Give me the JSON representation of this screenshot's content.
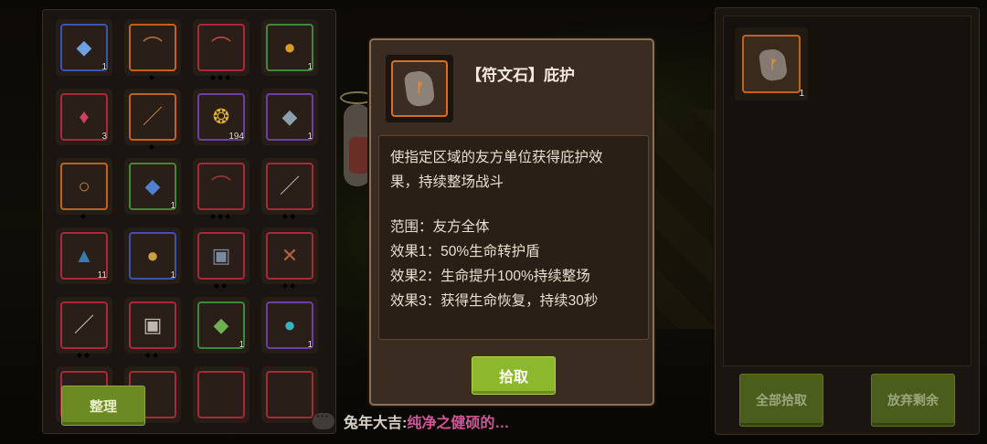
{
  "inventory": {
    "sort_button": "整理",
    "slots": [
      {
        "icon": "blue-gem-icon",
        "glyph": "◆",
        "color": "#6fa0e0",
        "border": "b-blue",
        "count": "1",
        "dots": ""
      },
      {
        "icon": "bow-icon",
        "glyph": "⌒",
        "color": "#b0703a",
        "border": "b-orange",
        "count": "",
        "dots": "◆"
      },
      {
        "icon": "red-bow-icon",
        "glyph": "⌒",
        "color": "#c04848",
        "border": "b-red",
        "count": "",
        "dots": "◆◆◆"
      },
      {
        "icon": "amber-drop-icon",
        "glyph": "●",
        "color": "#d89a2a",
        "border": "b-green",
        "count": "1",
        "dots": ""
      },
      {
        "icon": "potion-icon",
        "glyph": "♦",
        "color": "#d04060",
        "border": "b-red",
        "count": "3",
        "dots": ""
      },
      {
        "icon": "sword-icon",
        "glyph": "／",
        "color": "#d0803a",
        "border": "b-orange",
        "count": "",
        "dots": "◆"
      },
      {
        "icon": "gold-coin-icon",
        "glyph": "❂",
        "color": "#e0b030",
        "border": "b-purple",
        "count": "194",
        "dots": ""
      },
      {
        "icon": "crystal-icon",
        "glyph": "◆",
        "color": "#8aa0b0",
        "border": "b-purple",
        "count": "1",
        "dots": ""
      },
      {
        "icon": "ring-icon",
        "glyph": "○",
        "color": "#c08040",
        "border": "b-orange",
        "count": "",
        "dots": "◆"
      },
      {
        "icon": "sapphire-icon",
        "glyph": "◆",
        "color": "#5080d0",
        "border": "b-green",
        "count": "1",
        "dots": ""
      },
      {
        "icon": "locked-bow-icon",
        "glyph": "⌒",
        "color": "#a03a3a",
        "border": "b-red",
        "count": "",
        "dots": "◆◆◆"
      },
      {
        "icon": "blade-icon",
        "glyph": "／",
        "color": "#c0c0c0",
        "border": "b-red",
        "count": "",
        "dots": "◆◆"
      },
      {
        "icon": "eye-shard-icon",
        "glyph": "▲",
        "color": "#3a7ab0",
        "border": "b-red",
        "count": "11",
        "dots": ""
      },
      {
        "icon": "gold-ore-icon",
        "glyph": "●",
        "color": "#c8a040",
        "border": "b-blue",
        "count": "1",
        "dots": ""
      },
      {
        "icon": "armor-icon",
        "glyph": "▣",
        "color": "#7a8aa0",
        "border": "b-red",
        "count": "",
        "dots": "◆◆"
      },
      {
        "icon": "crossbow-icon",
        "glyph": "✕",
        "color": "#b06040",
        "border": "b-red",
        "count": "",
        "dots": "◆◆"
      },
      {
        "icon": "dagger-icon",
        "glyph": "／",
        "color": "#d0d0d0",
        "border": "b-red",
        "count": "",
        "dots": "◆◆"
      },
      {
        "icon": "plate-armor-icon",
        "glyph": "▣",
        "color": "#c0b8b0",
        "border": "b-red",
        "count": "",
        "dots": "◆◆"
      },
      {
        "icon": "green-rune-icon",
        "glyph": "◆",
        "color": "#70b050",
        "border": "b-green",
        "count": "1",
        "dots": ""
      },
      {
        "icon": "earth-orb-icon",
        "glyph": "●",
        "color": "#3ab0c0",
        "border": "b-purple",
        "count": "1",
        "dots": ""
      }
    ]
  },
  "popup": {
    "title": "【符文石】庇护",
    "item_icon": "rune-stone-icon",
    "rune_glyph": "ᚠ",
    "desc_line1": "使指定区域的友方单位获得庇护效",
    "desc_line2": "果，持续整场战斗",
    "range": "范围：友方全体",
    "effect1": "效果1：50%生命转护盾",
    "effect2": "效果2：生命提升100%持续整场",
    "effect3": "效果3：获得生命恢复，持续30秒",
    "pick_button": "拾取"
  },
  "right_panel": {
    "item_icon": "rune-stone-icon",
    "rune_glyph": "ᚠ",
    "item_count": "1",
    "pick_all_button": "全部拾取",
    "discard_rest_button": "放弃剩余"
  },
  "chat": {
    "name": "兔年大吉:",
    "message": "纯净之健硕的…"
  },
  "colors": {
    "accent_green": "#8eb82c",
    "rarity_orange": "#d86f20",
    "chat_pink": "#d0589a"
  }
}
